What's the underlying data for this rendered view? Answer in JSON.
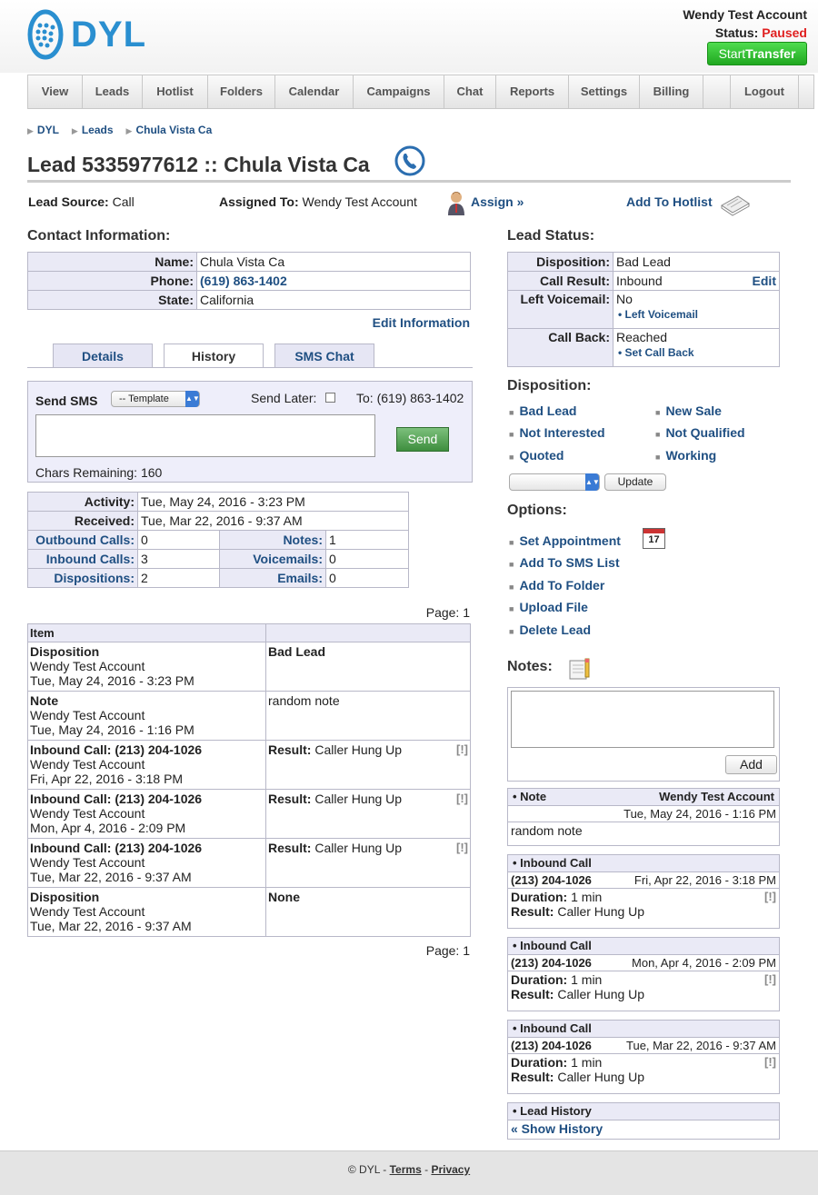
{
  "header": {
    "logo_text": "DYL",
    "account_name": "Wendy Test Account",
    "status_label": "Status:",
    "status_value": "Paused",
    "transfer_start": "Start",
    "transfer_bold": "Transfer"
  },
  "nav": [
    "View",
    "Leads",
    "Hotlist",
    "Folders",
    "Calendar",
    "Campaigns",
    "Chat",
    "Reports",
    "Settings",
    "Billing",
    "",
    "Logout"
  ],
  "breadcrumb": [
    "DYL",
    "Leads",
    "Chula Vista Ca"
  ],
  "page_title": "Lead 5335977612 :: Chula Vista Ca",
  "lead_meta": {
    "source_label": "Lead Source:",
    "source_value": "Call",
    "assigned_label": "Assigned To:",
    "assigned_value": "Wendy Test Account",
    "assign_link": "Assign »",
    "hotlist_link": "Add To Hotlist"
  },
  "contact": {
    "heading": "Contact Information:",
    "name_label": "Name:",
    "name_value": "Chula Vista Ca",
    "phone_label": "Phone:",
    "phone_value": "(619) 863-1402",
    "state_label": "State:",
    "state_value": "California",
    "edit_link": "Edit Information"
  },
  "tabs": [
    "Details",
    "History",
    "SMS Chat"
  ],
  "sms": {
    "label": "Send SMS",
    "template": "-- Template",
    "send_later": "Send Later:",
    "to": "To: (619) 863-1402",
    "send_button": "Send",
    "chars_remaining": "Chars Remaining: 160"
  },
  "stats": {
    "activity_label": "Activity:",
    "activity_value": "Tue, May 24, 2016 - 3:23 PM",
    "received_label": "Received:",
    "received_value": "Tue, Mar 22, 2016 - 9:37 AM",
    "outbound_label": "Outbound Calls:",
    "outbound_value": "0",
    "notes_label": "Notes:",
    "notes_value": "1",
    "inbound_label": "Inbound Calls:",
    "inbound_value": "3",
    "voicemails_label": "Voicemails:",
    "voicemails_value": "0",
    "dispositions_label": "Dispositions:",
    "dispositions_value": "2",
    "emails_label": "Emails:",
    "emails_value": "0"
  },
  "history": {
    "page_top": "Page: 1",
    "page_bottom": "Page: 1",
    "col_item": "Item",
    "rows": [
      {
        "title": "Disposition",
        "user": "Wendy Test Account",
        "date": "Tue, May 24, 2016 - 3:23 PM",
        "result_label": "",
        "result": "Bad Lead",
        "result_bold": true,
        "flag": ""
      },
      {
        "title": "Note",
        "user": "Wendy Test Account",
        "date": "Tue, May 24, 2016 - 1:16 PM",
        "result_label": "",
        "result": "random note",
        "result_bold": false,
        "flag": ""
      },
      {
        "title": "Inbound Call: (213) 204-1026",
        "user": "Wendy Test Account",
        "date": "Fri, Apr 22, 2016 - 3:18 PM",
        "result_label": "Result:",
        "result": "Caller Hung Up",
        "result_bold": false,
        "flag": "[!]"
      },
      {
        "title": "Inbound Call: (213) 204-1026",
        "user": "Wendy Test Account",
        "date": "Mon, Apr  4, 2016 - 2:09 PM",
        "result_label": "Result:",
        "result": "Caller Hung Up",
        "result_bold": false,
        "flag": "[!]"
      },
      {
        "title": "Inbound Call: (213) 204-1026",
        "user": "Wendy Test Account",
        "date": "Tue, Mar 22, 2016 - 9:37 AM",
        "result_label": "Result:",
        "result": "Caller Hung Up",
        "result_bold": false,
        "flag": "[!]"
      },
      {
        "title": "Disposition",
        "user": "Wendy Test Account",
        "date": "Tue, Mar 22, 2016 - 9:37 AM",
        "result_label": "",
        "result": "None",
        "result_bold": true,
        "flag": ""
      }
    ]
  },
  "lead_status": {
    "heading": "Lead Status:",
    "disposition_label": "Disposition:",
    "disposition_value": "Bad Lead",
    "call_result_label": "Call Result:",
    "call_result_value": "Inbound",
    "edit_link": "Edit",
    "left_vm_label": "Left Voicemail:",
    "left_vm_value": "No",
    "left_vm_link": "• Left Voicemail",
    "call_back_label": "Call Back:",
    "call_back_value": "Reached",
    "call_back_link": "• Set Call Back"
  },
  "disposition": {
    "heading": "Disposition:",
    "items": [
      "Bad Lead",
      "New Sale",
      "Not Interested",
      "Not Qualified",
      "Quoted",
      "Working"
    ],
    "update_button": "Update"
  },
  "options": {
    "heading": "Options:",
    "items": [
      "Set Appointment",
      "Add To SMS List",
      "Add To Folder",
      "Upload File",
      "Delete Lead"
    ],
    "calendar_day": "17"
  },
  "notes": {
    "heading": "Notes:",
    "add_button": "Add",
    "note_title": "• Note",
    "note_user": "Wendy Test Account",
    "note_date": "Tue, May 24, 2016 - 1:16 PM",
    "note_text": "random note",
    "calls": [
      {
        "title": "• Inbound Call",
        "phone": "(213) 204-1026",
        "date": "Fri, Apr 22, 2016 - 3:18 PM",
        "duration_label": "Duration:",
        "duration": "1 min",
        "result_label": "Result:",
        "result": "Caller Hung Up",
        "flag": "[!]"
      },
      {
        "title": "• Inbound Call",
        "phone": "(213) 204-1026",
        "date": "Mon, Apr 4, 2016 - 2:09 PM",
        "duration_label": "Duration:",
        "duration": "1 min",
        "result_label": "Result:",
        "result": "Caller Hung Up",
        "flag": "[!]"
      },
      {
        "title": "• Inbound Call",
        "phone": "(213) 204-1026",
        "date": "Tue, Mar 22, 2016 - 9:37 AM",
        "duration_label": "Duration:",
        "duration": "1 min",
        "result_label": "Result:",
        "result": "Caller Hung Up",
        "flag": "[!]"
      }
    ],
    "lead_history_title": "• Lead History",
    "show_history": "« Show History"
  },
  "footer": {
    "copyright": "© DYL -",
    "terms": "Terms",
    "sep": "-",
    "privacy": "Privacy"
  }
}
